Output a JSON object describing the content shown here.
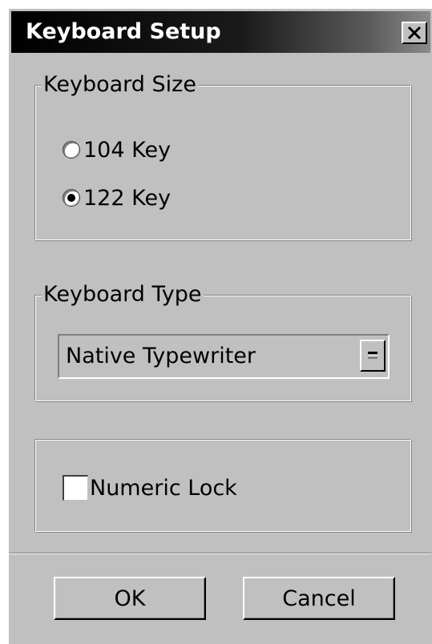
{
  "window": {
    "title": "Keyboard Setup"
  },
  "keyboard_size": {
    "legend": "Keyboard Size",
    "options": [
      {
        "label": "104 Key",
        "selected": false
      },
      {
        "label": "122 Key",
        "selected": true
      }
    ]
  },
  "keyboard_type": {
    "legend": "Keyboard Type",
    "selected_value": "Native Typewriter"
  },
  "numeric_lock": {
    "label": "Numeric Lock",
    "checked": false
  },
  "buttons": {
    "ok_label": "OK",
    "cancel_label": "Cancel"
  },
  "icons": {
    "close": "close-icon",
    "dropdown": "dropdown-arrow-icon"
  }
}
